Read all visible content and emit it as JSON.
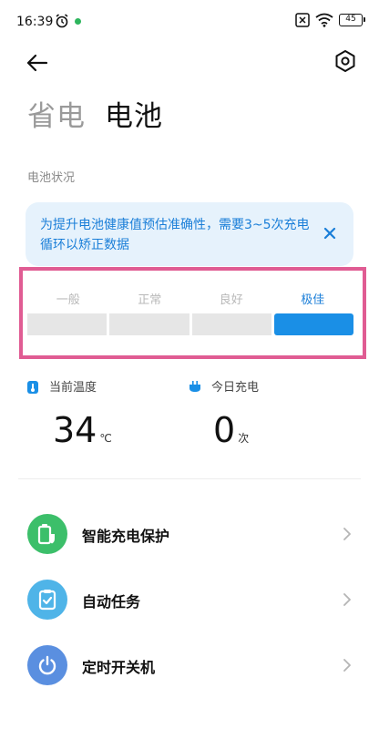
{
  "status_bar": {
    "time": "16:39",
    "battery": "45"
  },
  "header": {
    "tab_inactive": "省电",
    "tab_active": "电池"
  },
  "section_label": "电池状况",
  "notice": {
    "text": "为提升电池健康值预估准确性，需要3~5次充电循环以矫正数据"
  },
  "health_levels": {
    "labels": [
      "一般",
      "正常",
      "良好",
      "极佳"
    ],
    "active_index": 3
  },
  "stats": {
    "temperature": {
      "label": "当前温度",
      "value": "34",
      "unit": "℃"
    },
    "charge_count": {
      "label": "今日充电",
      "value": "0",
      "unit": "次"
    }
  },
  "menu": [
    {
      "label": "智能充电保护",
      "icon": "battery-shield-icon",
      "color": "#3cbf6a"
    },
    {
      "label": "自动任务",
      "icon": "clipboard-check-icon",
      "color": "#4fb4e8"
    },
    {
      "label": "定时开关机",
      "icon": "power-icon",
      "color": "#5a8fe0"
    }
  ],
  "colors": {
    "accent": "#1a7ed8",
    "highlight": "#e05c93",
    "bar_active": "#1a8fe6"
  }
}
